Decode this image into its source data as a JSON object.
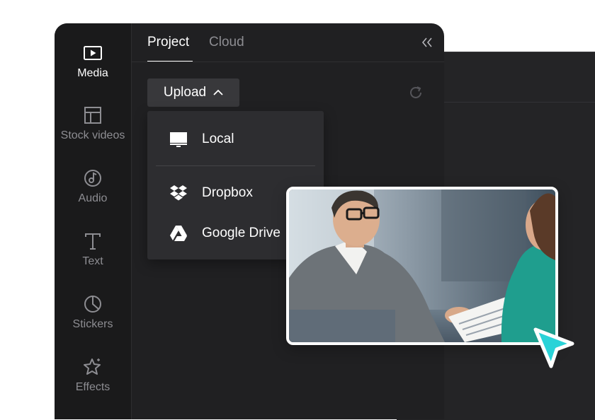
{
  "sidebar": {
    "items": [
      {
        "label": "Media",
        "icon": "play-icon",
        "active": true
      },
      {
        "label": "Stock videos",
        "icon": "layout-icon",
        "active": false
      },
      {
        "label": "Audio",
        "icon": "music-note-icon",
        "active": false
      },
      {
        "label": "Text",
        "icon": "text-icon",
        "active": false
      },
      {
        "label": "Stickers",
        "icon": "sticker-icon",
        "active": false
      },
      {
        "label": "Effects",
        "icon": "sparkle-icon",
        "active": false
      }
    ]
  },
  "tabs": [
    {
      "label": "Project",
      "active": true
    },
    {
      "label": "Cloud",
      "active": false
    }
  ],
  "upload": {
    "label": "Upload",
    "menu": [
      {
        "label": "Local",
        "icon": "monitor-icon"
      },
      {
        "label": "Dropbox",
        "icon": "dropbox-icon"
      },
      {
        "label": "Google Drive",
        "icon": "google-drive-icon"
      }
    ]
  },
  "colors": {
    "panel_bg": "#202022",
    "sidebar_bg": "#1a1a1b",
    "text_active": "#ffffff",
    "text_muted": "#8d8d92",
    "cursor_accent": "#2ad3d8"
  }
}
